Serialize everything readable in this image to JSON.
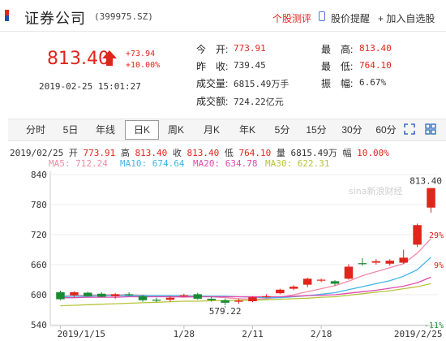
{
  "header": {
    "stock_name": "证券公司",
    "stock_code": "(399975.SZ)",
    "rating_label": "个股测评",
    "alert_label": "股价提醒",
    "add_label": "+ 加入自选股"
  },
  "quote": {
    "price": "813.40",
    "change": "+73.94",
    "change_pct": "+10.00%",
    "timestamp": "2019-02-25  15:01:27",
    "open_label": "今　开:",
    "open": "773.91",
    "prev_close_label": "昨　收:",
    "prev_close": "739.45",
    "volume_label": "成交量:",
    "volume": "6815.49万手",
    "amount_label": "成交额:",
    "amount": "724.22亿元",
    "high_label": "最　高:",
    "high": "813.40",
    "low_label": "最　低:",
    "low": "764.10",
    "amplitude_label": "振　幅:",
    "amplitude": "6.67%"
  },
  "tabs": [
    "分时",
    "5日",
    "年线",
    "日K",
    "周K",
    "月K",
    "年K",
    "5分",
    "15分",
    "30分",
    "60分"
  ],
  "info_line": {
    "date": "2019/02/25",
    "open_label": "开",
    "open": "773.91",
    "high_label": "高",
    "high": "813.40",
    "close_label": "收",
    "close": "813.40",
    "low_label": "低",
    "low": "764.10",
    "vol_label": "量",
    "vol": "6815.49万",
    "amp_label": "幅",
    "amp": "10.00%"
  },
  "ma_legend": {
    "ma5": "MA5: 712.24",
    "ma10": "MA10: 674.64",
    "ma20": "MA20: 634.78",
    "ma30": "MA30: 622.31"
  },
  "watermark": "sina新浪财经",
  "colors": {
    "up": "#e0251b",
    "down": "#1a8b34",
    "ma5": "#f08aa8",
    "ma10": "#3fb6e6",
    "ma20": "#e04ab0",
    "ma30": "#b7c43a"
  },
  "chart_data": {
    "type": "candlestick",
    "y_ticks": [
      840,
      780,
      720,
      660,
      600,
      540
    ],
    "y_pct_ticks": [
      "29%",
      "9%",
      "-11%"
    ],
    "ylim": [
      540,
      840
    ],
    "x_ticks": [
      "2019/1/15",
      "1/28",
      "2/11",
      "2/18",
      "2019/2/25"
    ],
    "annotations": {
      "max_label": "813.40",
      "min_label": "579.22"
    },
    "candles": [
      {
        "o": 605,
        "h": 608,
        "l": 589,
        "c": 591
      },
      {
        "o": 599,
        "h": 607,
        "l": 595,
        "c": 605
      },
      {
        "o": 604,
        "h": 606,
        "l": 596,
        "c": 597
      },
      {
        "o": 602,
        "h": 605,
        "l": 595,
        "c": 596
      },
      {
        "o": 597,
        "h": 603,
        "l": 592,
        "c": 601
      },
      {
        "o": 601,
        "h": 605,
        "l": 597,
        "c": 599
      },
      {
        "o": 597,
        "h": 600,
        "l": 586,
        "c": 589
      },
      {
        "o": 590,
        "h": 594,
        "l": 585,
        "c": 588
      },
      {
        "o": 590,
        "h": 598,
        "l": 586,
        "c": 594
      },
      {
        "o": 598,
        "h": 602,
        "l": 596,
        "c": 599
      },
      {
        "o": 601,
        "h": 604,
        "l": 590,
        "c": 592
      },
      {
        "o": 592,
        "h": 596,
        "l": 586,
        "c": 589
      },
      {
        "o": 589,
        "h": 592,
        "l": 579,
        "c": 584
      },
      {
        "o": 586,
        "h": 592,
        "l": 582,
        "c": 588
      },
      {
        "o": 587,
        "h": 597,
        "l": 585,
        "c": 595
      },
      {
        "o": 597,
        "h": 601,
        "l": 594,
        "c": 597
      },
      {
        "o": 603,
        "h": 612,
        "l": 601,
        "c": 610
      },
      {
        "o": 612,
        "h": 619,
        "l": 609,
        "c": 616
      },
      {
        "o": 620,
        "h": 634,
        "l": 615,
        "c": 632
      },
      {
        "o": 630,
        "h": 632,
        "l": 625,
        "c": 630
      },
      {
        "o": 627,
        "h": 629,
        "l": 618,
        "c": 622
      },
      {
        "o": 632,
        "h": 661,
        "l": 630,
        "c": 656
      },
      {
        "o": 663,
        "h": 673,
        "l": 658,
        "c": 662
      },
      {
        "o": 664,
        "h": 671,
        "l": 660,
        "c": 667
      },
      {
        "o": 662,
        "h": 671,
        "l": 658,
        "c": 668
      },
      {
        "o": 664,
        "h": 690,
        "l": 662,
        "c": 674
      },
      {
        "o": 700,
        "h": 742,
        "l": 695,
        "c": 739
      },
      {
        "o": 774,
        "h": 813,
        "l": 764,
        "c": 813
      }
    ],
    "series": [
      {
        "name": "MA5",
        "values": [
          597,
          598,
          599,
          600,
          600,
          600,
          599,
          597,
          596,
          595,
          596,
          596,
          594,
          592,
          591,
          592,
          595,
          600,
          606,
          612,
          618,
          627,
          638,
          646,
          654,
          662,
          683,
          712
        ]
      },
      {
        "name": "MA10",
        "values": [
          596,
          597,
          597,
          598,
          598,
          598,
          598,
          598,
          598,
          598,
          597,
          597,
          597,
          596,
          595,
          594,
          594,
          596,
          598,
          601,
          604,
          610,
          616,
          622,
          628,
          637,
          650,
          675
        ]
      },
      {
        "name": "MA20",
        "values": [
          594,
          594,
          595,
          595,
          595,
          596,
          596,
          596,
          596,
          596,
          596,
          596,
          596,
          596,
          596,
          596,
          596,
          597,
          598,
          599,
          600,
          603,
          606,
          609,
          613,
          617,
          624,
          635
        ]
      },
      {
        "name": "MA30",
        "values": [
          578,
          579,
          580,
          581,
          582,
          583,
          584,
          585,
          586,
          587,
          587,
          588,
          588,
          589,
          589,
          590,
          591,
          592,
          593,
          595,
          596,
          599,
          602,
          605,
          608,
          612,
          616,
          622
        ]
      }
    ]
  }
}
